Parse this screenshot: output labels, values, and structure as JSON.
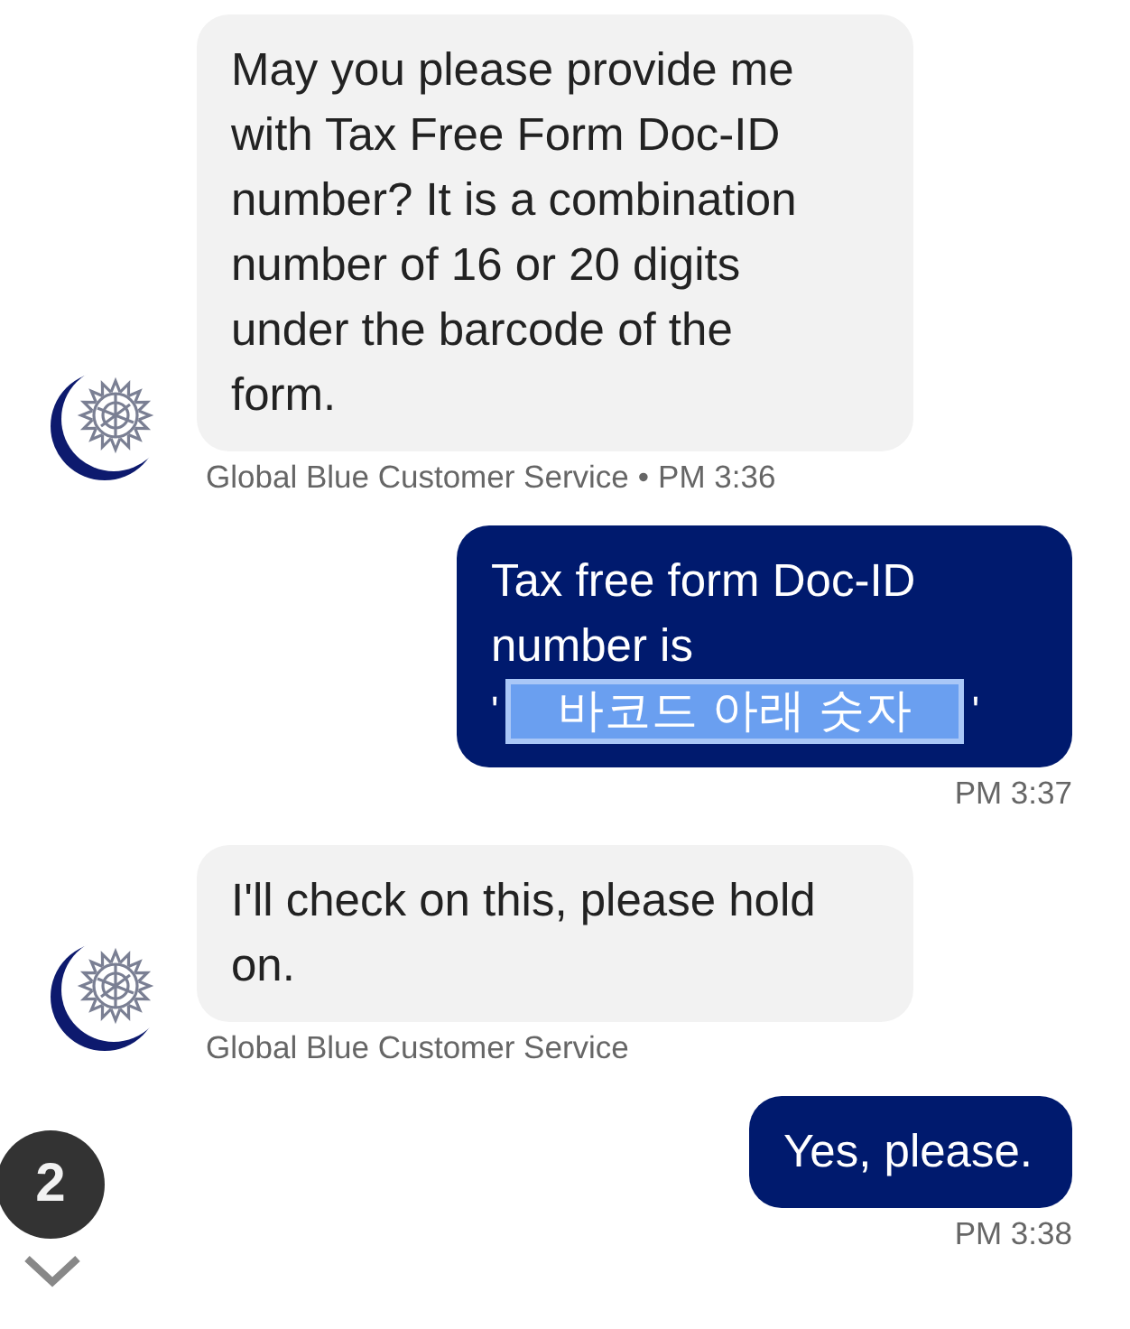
{
  "messages": [
    {
      "kind": "received",
      "segments": [
        {
          "kind": "plain",
          "text": "May you please provide me with Tax Free Form Doc-ID number? It is a combination number of 16 or 20 digits under the barcode of the form."
        }
      ],
      "sender": "Global Blue Customer Service",
      "separator": "•",
      "time": "PM 3:36"
    },
    {
      "kind": "sent",
      "segments": [
        {
          "kind": "plain",
          "text": "Tax free form Doc-ID number is"
        },
        {
          "kind": "quote",
          "text": "'"
        },
        {
          "kind": "highlight",
          "text": "바코드 아래 숫자"
        },
        {
          "kind": "quote",
          "text": "'"
        }
      ],
      "time": "PM 3:37"
    },
    {
      "kind": "received",
      "segments": [
        {
          "kind": "plain",
          "text": "I'll check on this, please hold on."
        }
      ],
      "sender": "Global Blue Customer Service"
    },
    {
      "kind": "sent",
      "segments": [
        {
          "kind": "plain",
          "text": "Yes, please."
        }
      ],
      "time": "PM 3:38"
    }
  ],
  "unread_badge": "2"
}
